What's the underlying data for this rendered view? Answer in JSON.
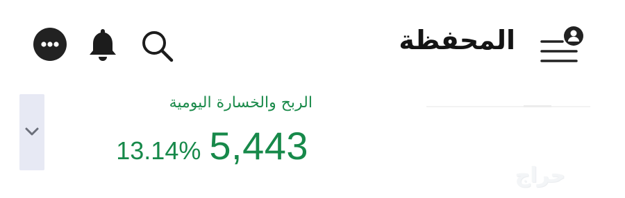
{
  "header": {
    "title": "المحفظة",
    "icons": {
      "more": "more-horizontal-icon",
      "notifications": "bell-icon",
      "search": "search-icon",
      "menu": "menu-with-profile-icon"
    }
  },
  "daily_pnl": {
    "label": "الربح والخسارة اليومية",
    "value": "5,443",
    "percent": "13.14%",
    "color": "#17894a"
  },
  "watermark": {
    "text": "حراج"
  },
  "colors": {
    "icon_dark": "#222222",
    "dropdown_bg": "#e7e9f4",
    "chevron": "#6b6f7a"
  }
}
